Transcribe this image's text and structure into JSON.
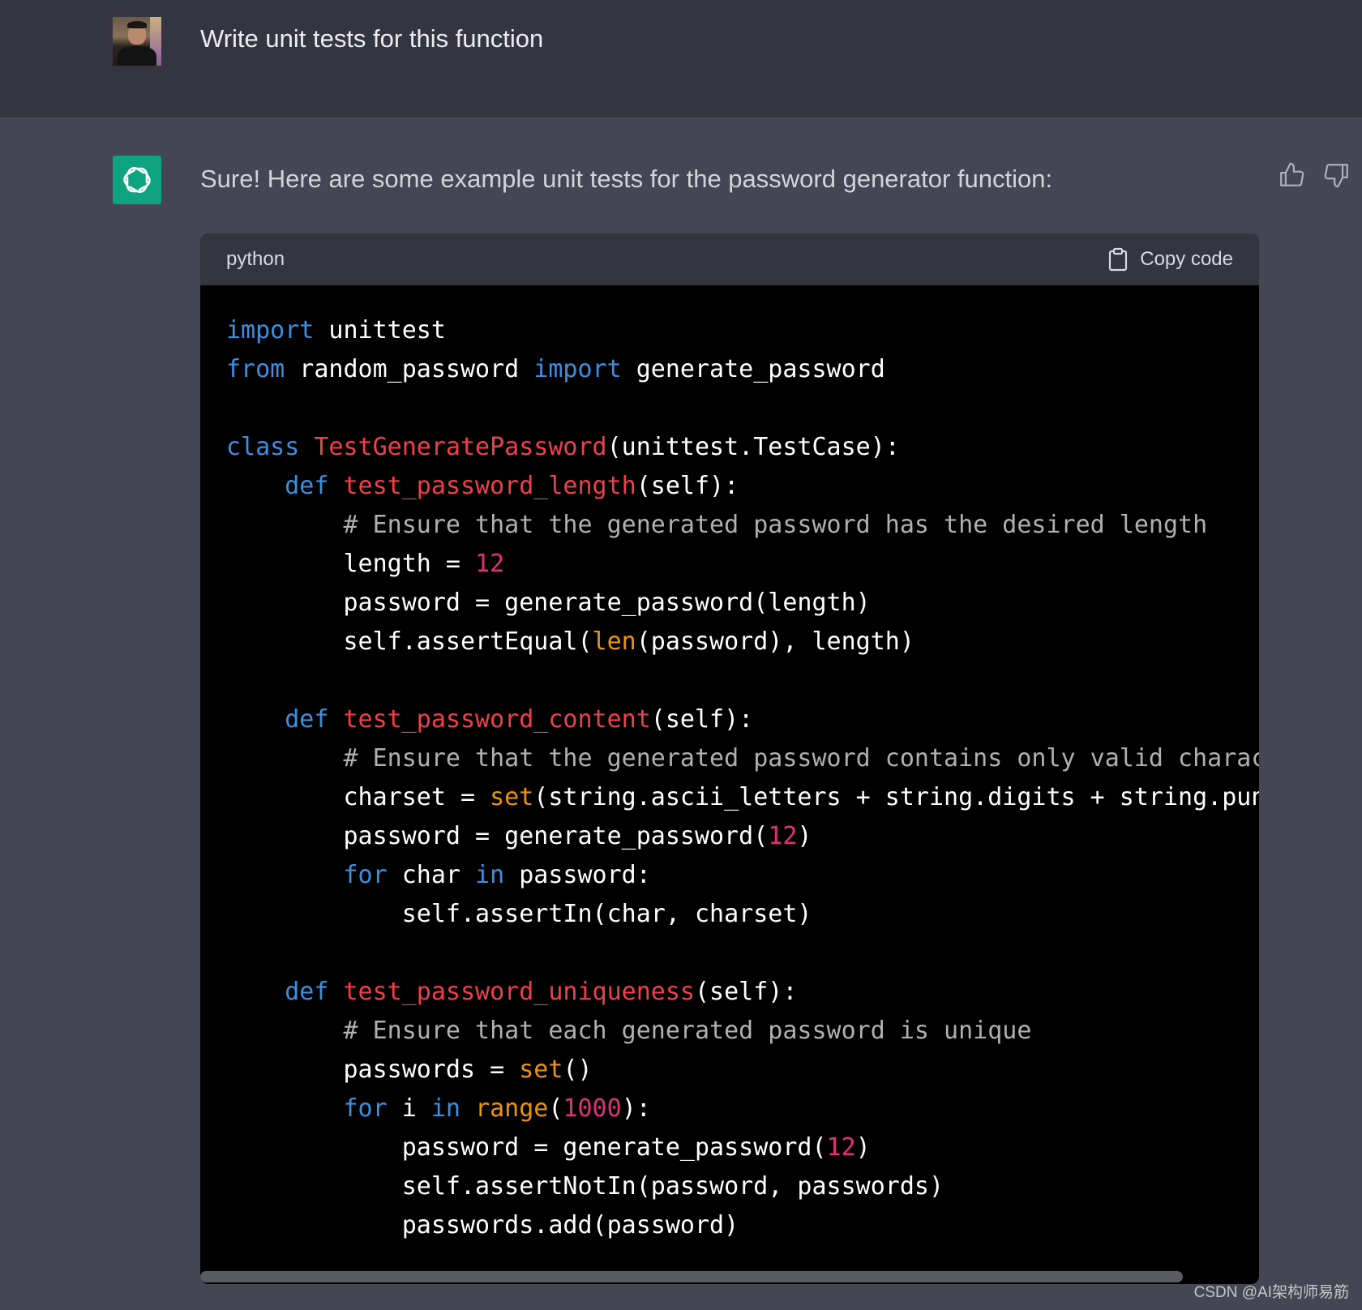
{
  "user_message": {
    "text": "Write unit tests for this function"
  },
  "assistant_message": {
    "text": "Sure! Here are some example unit tests for the password generator function:"
  },
  "code_block": {
    "language": "python",
    "copy_label": "Copy code",
    "lines": [
      [
        {
          "t": "import",
          "c": "kw"
        },
        {
          "t": " unittest",
          "c": ""
        }
      ],
      [
        {
          "t": "from",
          "c": "kw"
        },
        {
          "t": " random_password ",
          "c": ""
        },
        {
          "t": "import",
          "c": "kw"
        },
        {
          "t": " generate_password",
          "c": ""
        }
      ],
      [],
      [
        {
          "t": "class",
          "c": "kw"
        },
        {
          "t": " ",
          "c": ""
        },
        {
          "t": "TestGeneratePassword",
          "c": "cls"
        },
        {
          "t": "(unittest.TestCase):",
          "c": ""
        }
      ],
      [
        {
          "t": "    ",
          "c": ""
        },
        {
          "t": "def",
          "c": "kw"
        },
        {
          "t": " ",
          "c": ""
        },
        {
          "t": "test_password_length",
          "c": "fn"
        },
        {
          "t": "(self):",
          "c": ""
        }
      ],
      [
        {
          "t": "        ",
          "c": ""
        },
        {
          "t": "# Ensure that the generated password has the desired length",
          "c": "cm"
        }
      ],
      [
        {
          "t": "        length = ",
          "c": ""
        },
        {
          "t": "12",
          "c": "num"
        }
      ],
      [
        {
          "t": "        password = generate_password(length)",
          "c": ""
        }
      ],
      [
        {
          "t": "        self.assertEqual(",
          "c": ""
        },
        {
          "t": "len",
          "c": "bi"
        },
        {
          "t": "(password), length)",
          "c": ""
        }
      ],
      [],
      [
        {
          "t": "    ",
          "c": ""
        },
        {
          "t": "def",
          "c": "kw"
        },
        {
          "t": " ",
          "c": ""
        },
        {
          "t": "test_password_content",
          "c": "fn"
        },
        {
          "t": "(self):",
          "c": ""
        }
      ],
      [
        {
          "t": "        ",
          "c": ""
        },
        {
          "t": "# Ensure that the generated password contains only valid characters",
          "c": "cm"
        }
      ],
      [
        {
          "t": "        charset = ",
          "c": ""
        },
        {
          "t": "set",
          "c": "bi"
        },
        {
          "t": "(string.ascii_letters + string.digits + string.punctuat",
          "c": ""
        }
      ],
      [
        {
          "t": "        password = generate_password(",
          "c": ""
        },
        {
          "t": "12",
          "c": "num"
        },
        {
          "t": ")",
          "c": ""
        }
      ],
      [
        {
          "t": "        ",
          "c": ""
        },
        {
          "t": "for",
          "c": "kw"
        },
        {
          "t": " char ",
          "c": ""
        },
        {
          "t": "in",
          "c": "kw"
        },
        {
          "t": " password:",
          "c": ""
        }
      ],
      [
        {
          "t": "            self.assertIn(char, charset)",
          "c": ""
        }
      ],
      [],
      [
        {
          "t": "    ",
          "c": ""
        },
        {
          "t": "def",
          "c": "kw"
        },
        {
          "t": " ",
          "c": ""
        },
        {
          "t": "test_password_uniqueness",
          "c": "fn"
        },
        {
          "t": "(self):",
          "c": ""
        }
      ],
      [
        {
          "t": "        ",
          "c": ""
        },
        {
          "t": "# Ensure that each generated password is unique",
          "c": "cm"
        }
      ],
      [
        {
          "t": "        passwords = ",
          "c": ""
        },
        {
          "t": "set",
          "c": "bi"
        },
        {
          "t": "()",
          "c": ""
        }
      ],
      [
        {
          "t": "        ",
          "c": ""
        },
        {
          "t": "for",
          "c": "kw"
        },
        {
          "t": " i ",
          "c": ""
        },
        {
          "t": "in",
          "c": "kw"
        },
        {
          "t": " ",
          "c": ""
        },
        {
          "t": "range",
          "c": "bi"
        },
        {
          "t": "(",
          "c": ""
        },
        {
          "t": "1000",
          "c": "num"
        },
        {
          "t": "):",
          "c": ""
        }
      ],
      [
        {
          "t": "            password = generate_password(",
          "c": ""
        },
        {
          "t": "12",
          "c": "num"
        },
        {
          "t": ")",
          "c": ""
        }
      ],
      [
        {
          "t": "            self.assertNotIn(password, passwords)",
          "c": ""
        }
      ],
      [
        {
          "t": "            passwords.add(password)",
          "c": ""
        }
      ]
    ]
  },
  "watermark": {
    "text": "CSDN @AI架构师易筋"
  },
  "colors": {
    "page_bg": "#444654",
    "user_row_bg": "#343541",
    "code_bg": "#000000",
    "keyword": "#3e8ee0",
    "function_name": "#f03e4a",
    "number": "#df3079",
    "builtin": "#e9950c",
    "comment": "#b0b0b0",
    "brand_green": "#10a37f"
  },
  "icons": {
    "bot_avatar": "openai-logo-icon",
    "thumbs_up": "thumbs-up-icon",
    "thumbs_down": "thumbs-down-icon",
    "copy": "clipboard-icon"
  }
}
